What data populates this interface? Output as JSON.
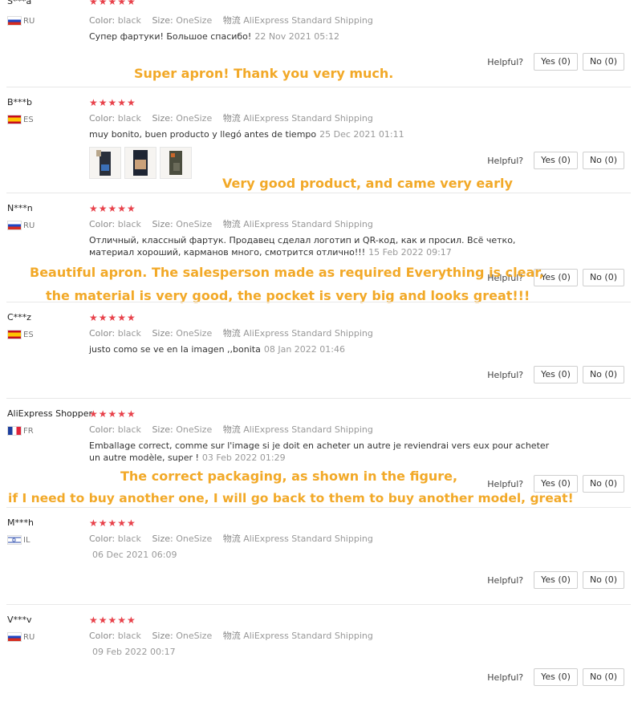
{
  "helpful_label": "Helpful?",
  "reviews": [
    {
      "name": "S***a",
      "country": "RU",
      "color_label": "Color:",
      "color": "black",
      "size_label": "Size:",
      "size": "OneSize",
      "logistics_label": "物流",
      "shipping": "AliExpress Standard Shipping",
      "text": "Супер фартуки! Большое спасибо!",
      "date": "22 Nov 2021 05:12",
      "yes": "Yes (0)",
      "no": "No (0)"
    },
    {
      "name": "B***b",
      "country": "ES",
      "color_label": "Color:",
      "color": "black",
      "size_label": "Size:",
      "size": "OneSize",
      "logistics_label": "物流",
      "shipping": "AliExpress Standard Shipping",
      "text": "muy bonito, buen producto y llegó antes de tiempo",
      "date": "25 Dec 2021 01:11",
      "yes": "Yes (0)",
      "no": "No (0)"
    },
    {
      "name": "N***n",
      "country": "RU",
      "color_label": "Color:",
      "color": "black",
      "size_label": "Size:",
      "size": "OneSize",
      "logistics_label": "物流",
      "shipping": "AliExpress Standard Shipping",
      "text": "Отличный, классный фартук. Продавец сделал логотип и QR-код, как и просил. Всё четко, материал хороший, карманов много, смотрится отлично!!!",
      "date": "15 Feb 2022 09:17",
      "yes": "Yes (0)",
      "no": "No (0)"
    },
    {
      "name": "C***z",
      "country": "ES",
      "color_label": "Color:",
      "color": "black",
      "size_label": "Size:",
      "size": "OneSize",
      "logistics_label": "物流",
      "shipping": "AliExpress Standard Shipping",
      "text": "justo como se ve en la imagen ,,bonita",
      "date": "08 Jan 2022 01:46",
      "yes": "Yes (0)",
      "no": "No (0)"
    },
    {
      "name": "AliExpress Shopper",
      "country": "FR",
      "color_label": "Color:",
      "color": "black",
      "size_label": "Size:",
      "size": "OneSize",
      "logistics_label": "物流",
      "shipping": "AliExpress Standard Shipping",
      "text": "Emballage correct, comme sur l'image si je doit en acheter un autre je reviendrai vers eux pour acheter un autre modèle, super !",
      "date": "03 Feb 2022 01:29",
      "yes": "Yes (0)",
      "no": "No (0)"
    },
    {
      "name": "M***h",
      "country": "IL",
      "color_label": "Color:",
      "color": "black",
      "size_label": "Size:",
      "size": "OneSize",
      "logistics_label": "物流",
      "shipping": "AliExpress Standard Shipping",
      "text": "",
      "date": "06 Dec 2021 06:09",
      "yes": "Yes (0)",
      "no": "No (0)"
    },
    {
      "name": "V***v",
      "country": "RU",
      "color_label": "Color:",
      "color": "black",
      "size_label": "Size:",
      "size": "OneSize",
      "logistics_label": "物流",
      "shipping": "AliExpress Standard Shipping",
      "text": "",
      "date": "09 Feb 2022 00:17",
      "yes": "Yes (0)",
      "no": "No (0)"
    }
  ],
  "captions": {
    "c1": "Super apron! Thank you very much.",
    "c2": "Very good product, and came very early",
    "c3a": "Beautiful apron. The salesperson made as required Everything is clear,",
    "c3b": "the material is very good, the pocket is very big and looks great!!!",
    "c5a": "The correct packaging, as shown in the figure,",
    "c5b": "if I need to buy another one, I will go back to them to buy another model, great!"
  },
  "colors": {
    "star": "#e8424b",
    "caption": "#f2a928"
  }
}
